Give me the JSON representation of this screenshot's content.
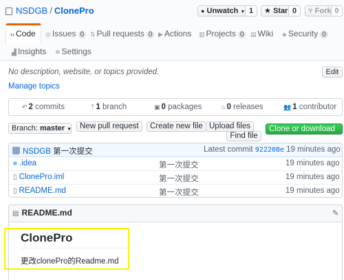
{
  "repo": {
    "owner": "NSDGB",
    "separator": "/",
    "name": "ClonePro"
  },
  "actions": {
    "watch": {
      "label": "Unwatch",
      "count": "1"
    },
    "star": {
      "label": "Star",
      "count": "0"
    },
    "fork": {
      "label": "Fork",
      "count": "0"
    }
  },
  "tabs": [
    {
      "label": "Code",
      "icon": "code-icon"
    },
    {
      "label": "Issues",
      "count": "0",
      "icon": "issue-icon"
    },
    {
      "label": "Pull requests",
      "count": "0",
      "icon": "pull-request-icon"
    },
    {
      "label": "Actions",
      "icon": "actions-icon"
    },
    {
      "label": "Projects",
      "count": "0",
      "icon": "project-icon"
    },
    {
      "label": "Wiki",
      "icon": "wiki-icon"
    },
    {
      "label": "Security",
      "count": "0",
      "icon": "shield-icon"
    },
    {
      "label": "Insights",
      "icon": "graph-icon"
    },
    {
      "label": "Settings",
      "icon": "gear-icon"
    }
  ],
  "about": {
    "description": "No description, website, or topics provided.",
    "edit_label": "Edit",
    "manage_topics": "Manage topics"
  },
  "summary": [
    {
      "count": "2",
      "label": "commits",
      "icon": "history-icon"
    },
    {
      "count": "1",
      "label": "branch",
      "icon": "branch-icon"
    },
    {
      "count": "0",
      "label": "packages",
      "icon": "package-icon"
    },
    {
      "count": "0",
      "label": "releases",
      "icon": "tag-icon"
    },
    {
      "count": "1",
      "label": "contributor",
      "icon": "people-icon"
    }
  ],
  "toolbar": {
    "branch_prefix": "Branch:",
    "branch_name": "master",
    "new_pull_request": "New pull request",
    "create_new_file": "Create new file",
    "upload_files": "Upload files",
    "find_file": "Find file",
    "clone_download": "Clone or download"
  },
  "latest_commit": {
    "author": "NSDGB",
    "message": "第一次提交",
    "prefix": "Latest commit",
    "sha": "922208e",
    "age": "19 minutes ago"
  },
  "files": [
    {
      "name": ".idea",
      "type": "folder",
      "message": "第一次提交",
      "age": "19 minutes ago"
    },
    {
      "name": "ClonePro.iml",
      "type": "file",
      "message": "第一次提交",
      "age": "19 minutes ago"
    },
    {
      "name": "README.md",
      "type": "file",
      "message": "第一次提交",
      "age": "19 minutes ago"
    }
  ],
  "readme": {
    "filename": "README.md",
    "heading": "ClonePro",
    "body": "更改clonePro的Readme.md"
  },
  "colors": {
    "link": "#0366d6",
    "clone_button": "#28a745",
    "active_tab": "#e36209",
    "highlight_box": "#f5f500"
  }
}
